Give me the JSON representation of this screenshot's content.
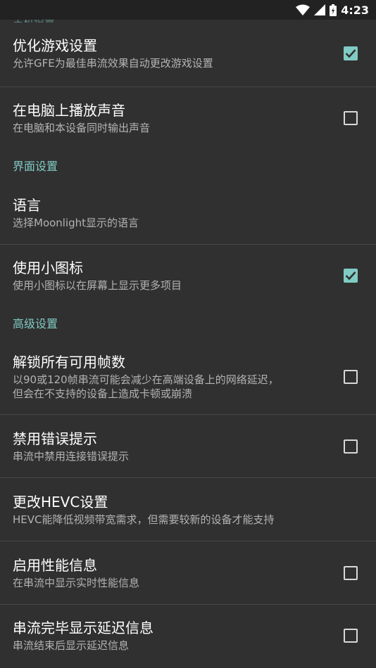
{
  "status_bar": {
    "time": "4:23"
  },
  "cut_header": "主机设置",
  "categories": {
    "ui": "界面设置",
    "advanced": "高级设置"
  },
  "prefs": [
    {
      "title": "优化游戏设置",
      "summary": "允许GFE为最佳串流效果自动更改游戏设置",
      "checked": true
    },
    {
      "title": "在电脑上播放声音",
      "summary": "在电脑和本设备同时输出声音",
      "checked": false
    },
    {
      "title": "语言",
      "summary": "选择Moonlight显示的语言"
    },
    {
      "title": "使用小图标",
      "summary": "使用小图标以在屏幕上显示更多项目",
      "checked": true
    },
    {
      "title": "解锁所有可用帧数",
      "summary_line1": "以90或120帧串流可能会减少在高端设备上的网络延迟，",
      "summary_line2": "但会在不支持的设备上造成卡顿或崩溃",
      "checked": false
    },
    {
      "title": "禁用错误提示",
      "summary": "串流中禁用连接错误提示",
      "checked": false
    },
    {
      "title": "更改HEVC设置",
      "summary": "HEVC能降低视频带宽需求，但需要较新的设备才能支持"
    },
    {
      "title": "启用性能信息",
      "summary": "在串流中显示实时性能信息",
      "checked": false
    },
    {
      "title": "串流完毕显示延迟信息",
      "summary": "串流结束后显示延迟信息",
      "checked": false
    }
  ],
  "colors": {
    "accent": "#80cbc4",
    "background": "#303030",
    "statusbar": "#222222"
  }
}
